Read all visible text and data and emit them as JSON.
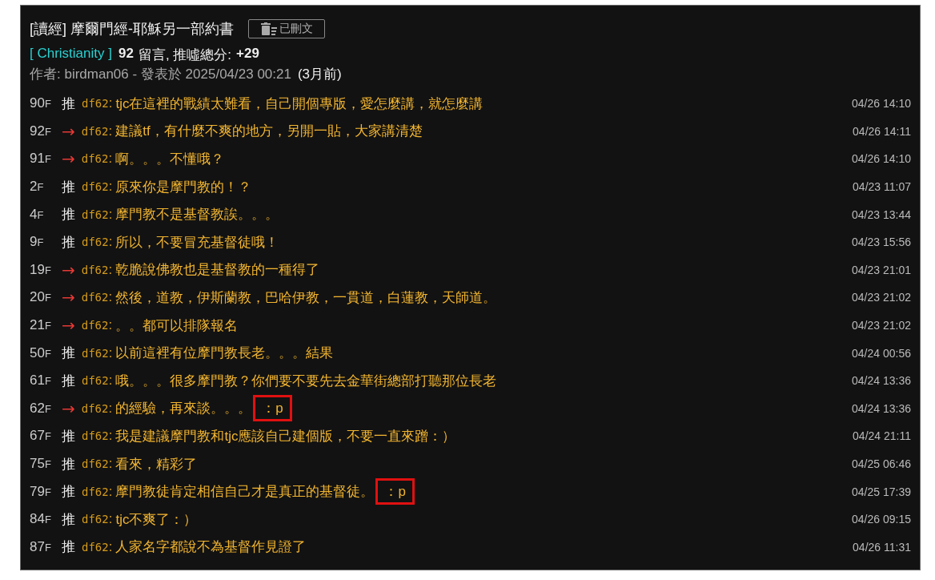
{
  "post": {
    "title": "[讀經] 摩爾門經-耶穌另一部約書",
    "deleted_label": "已刪文",
    "board": "[ Christianity ]",
    "comment_count": "92",
    "comment_label": "留言, 推噓總分:",
    "score": "+29",
    "author_line": "作者: birdman06 - 發表於 2025/04/23 00:21",
    "age": "(3月前)"
  },
  "comments": [
    {
      "floor": "90",
      "unit": "F",
      "kind": "push",
      "tag": "推",
      "user": "df62",
      "sep": ":",
      "text": "tjc在這裡的戰績太難看，自己開個專版，愛怎麼講，就怎麼講",
      "time": "04/26 14:10"
    },
    {
      "floor": "92",
      "unit": "F",
      "kind": "arrow",
      "tag": "→",
      "user": "df62",
      "sep": ":",
      "text": "建議tf，有什麼不爽的地方，另開一貼，大家講清楚",
      "time": "04/26 14:11"
    },
    {
      "floor": "91",
      "unit": "F",
      "kind": "arrow",
      "tag": "→",
      "user": "df62",
      "sep": ":",
      "text": "啊。。。不懂哦？",
      "time": "04/26 14:10"
    },
    {
      "floor": "2",
      "unit": "F",
      "kind": "push",
      "tag": "推",
      "user": "df62",
      "sep": ":",
      "text": "原來你是摩門教的！？",
      "time": "04/23 11:07"
    },
    {
      "floor": "4",
      "unit": "F",
      "kind": "push",
      "tag": "推",
      "user": "df62",
      "sep": ":",
      "text": "摩門教不是基督教誒。。。",
      "time": "04/23 13:44"
    },
    {
      "floor": "9",
      "unit": "F",
      "kind": "push",
      "tag": "推",
      "user": "df62",
      "sep": ":",
      "text": "所以，不要冒充基督徒哦！",
      "time": "04/23 15:56"
    },
    {
      "floor": "19",
      "unit": "F",
      "kind": "arrow",
      "tag": "→",
      "user": "df62",
      "sep": ":",
      "text": "乾脆說佛教也是基督教的一種得了",
      "time": "04/23 21:01"
    },
    {
      "floor": "20",
      "unit": "F",
      "kind": "arrow",
      "tag": "→",
      "user": "df62",
      "sep": ":",
      "text": "然後，道教，伊斯蘭教，巴哈伊教，一貫道，白蓮教，天師道。",
      "time": "04/23 21:02"
    },
    {
      "floor": "21",
      "unit": "F",
      "kind": "arrow",
      "tag": "→",
      "user": "df62",
      "sep": ":",
      "text": "。。都可以排隊報名",
      "time": "04/23 21:02"
    },
    {
      "floor": "50",
      "unit": "F",
      "kind": "push",
      "tag": "推",
      "user": "df62",
      "sep": ":",
      "text": "以前這裡有位摩門教長老。。。結果",
      "time": "04/24 00:56"
    },
    {
      "floor": "61",
      "unit": "F",
      "kind": "push",
      "tag": "推",
      "user": "df62",
      "sep": ":",
      "text": "哦。。。很多摩門教？你們要不要先去金華街總部打聽那位長老",
      "time": "04/24 13:36"
    },
    {
      "floor": "62",
      "unit": "F",
      "kind": "arrow",
      "tag": "→",
      "user": "df62",
      "sep": ":",
      "text": "的經驗，再來談。。。",
      "highlight": "：p",
      "time": "04/24 13:36"
    },
    {
      "floor": "67",
      "unit": "F",
      "kind": "push",
      "tag": "推",
      "user": "df62",
      "sep": ":",
      "text": "我是建議摩門教和tjc應該自己建個版，不要一直來蹭：）",
      "time": "04/24 21:11"
    },
    {
      "floor": "75",
      "unit": "F",
      "kind": "push",
      "tag": "推",
      "user": "df62",
      "sep": ":",
      "text": "看來，精彩了",
      "time": "04/25 06:46"
    },
    {
      "floor": "79",
      "unit": "F",
      "kind": "push",
      "tag": "推",
      "user": "df62",
      "sep": ":",
      "text": "摩門教徒肯定相信自己才是真正的基督徒。",
      "highlight": "：p",
      "time": "04/25 17:39"
    },
    {
      "floor": "84",
      "unit": "F",
      "kind": "push",
      "tag": "推",
      "user": "df62",
      "sep": ":",
      "text": "tjc不爽了：）",
      "time": "04/26 09:15"
    },
    {
      "floor": "87",
      "unit": "F",
      "kind": "push",
      "tag": "推",
      "user": "df62",
      "sep": ":",
      "text": "人家名字都說不為基督作見證了",
      "time": "04/26 11:31"
    }
  ]
}
